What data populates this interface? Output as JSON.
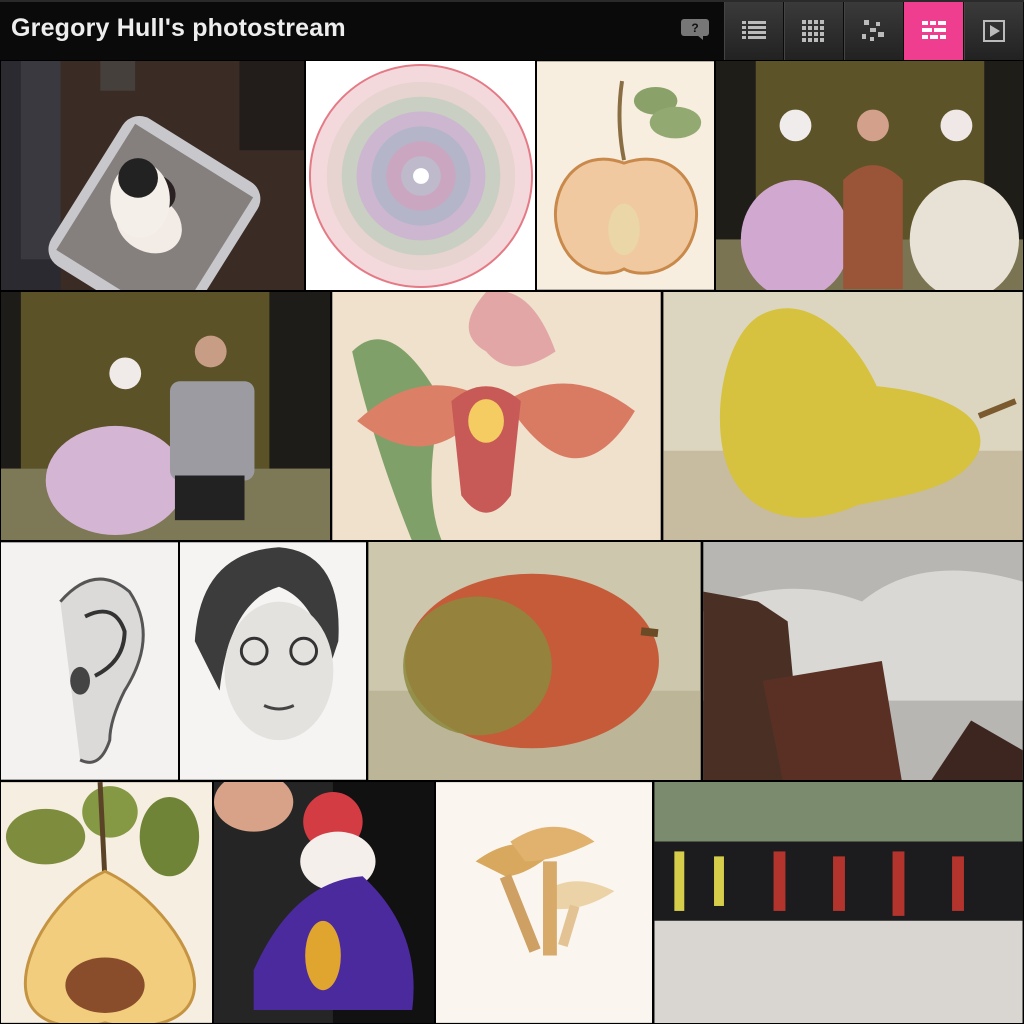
{
  "header": {
    "title": "Gregory Hull's photostream",
    "comment_icon": "speech-bubble-question-icon",
    "views": [
      {
        "name": "list-view",
        "icon": "list-icon",
        "active": false
      },
      {
        "name": "grid-view",
        "icon": "grid-icon",
        "active": false
      },
      {
        "name": "scatter-view",
        "icon": "scatter-icon",
        "active": false
      },
      {
        "name": "mosaic-view",
        "icon": "mosaic-icon",
        "active": true
      },
      {
        "name": "slideshow",
        "icon": "play-icon",
        "active": false
      }
    ],
    "accent": "#ef3d8f"
  },
  "photos": [
    {
      "id": "dog-iphone",
      "subject": "Dog held behind an iPhone"
    },
    {
      "id": "mandala",
      "subject": "Circular string mandala"
    },
    {
      "id": "apple",
      "subject": "Halved apple illustration"
    },
    {
      "id": "geisha-trio",
      "subject": "Two maiko and a woman"
    },
    {
      "id": "geisha-man",
      "subject": "Maiko with a man"
    },
    {
      "id": "orchid",
      "subject": "Slipper orchid painting"
    },
    {
      "id": "pear",
      "subject": "Yellow pear painting"
    },
    {
      "id": "ear",
      "subject": "Ear pencil sketch"
    },
    {
      "id": "portrait",
      "subject": "Pencil portrait with glasses"
    },
    {
      "id": "mango",
      "subject": "Mango painting"
    },
    {
      "id": "mountains",
      "subject": "Temple roof and misty mountains"
    },
    {
      "id": "quince",
      "subject": "Halved pear illustration"
    },
    {
      "id": "costume-dog",
      "subject": "Dog in purple costume"
    },
    {
      "id": "mushrooms",
      "subject": "Mushroom illustration"
    },
    {
      "id": "festival",
      "subject": "Festival crowd"
    }
  ]
}
